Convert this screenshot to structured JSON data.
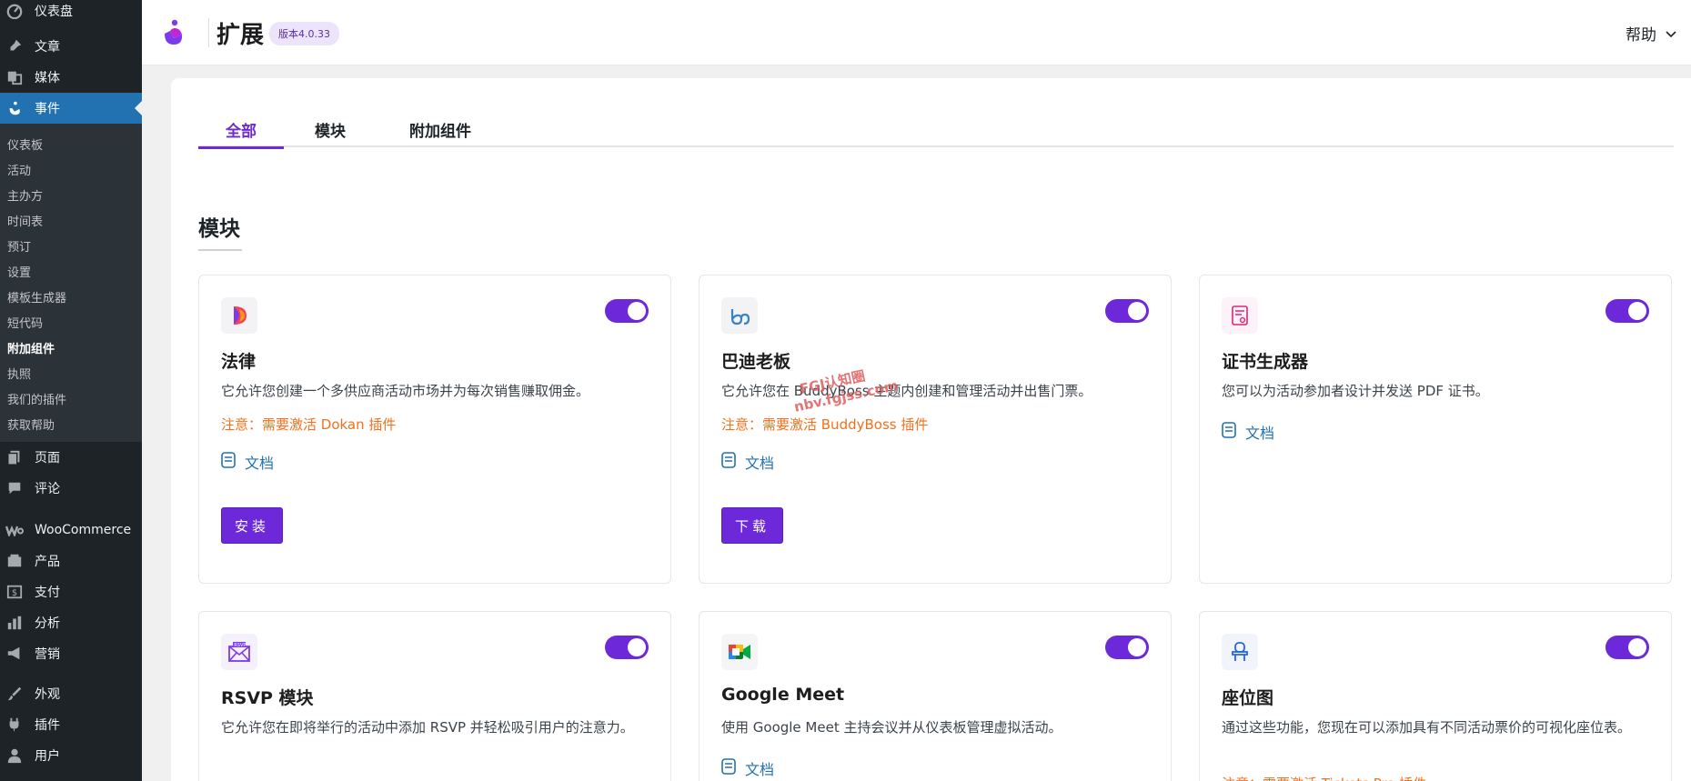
{
  "sidebar": {
    "top_items": [
      {
        "label": "仪表盘",
        "icon": "dashboard-icon"
      },
      {
        "label": "文章",
        "icon": "pin-icon"
      },
      {
        "label": "媒体",
        "icon": "media-icon"
      },
      {
        "label": "事件",
        "icon": "events-icon"
      }
    ],
    "submenu": [
      "仪表板",
      "活动",
      "主办方",
      "时间表",
      "预订",
      "设置",
      "模板生成器",
      "短代码",
      "附加组件",
      "执照",
      "我们的插件",
      "获取帮助"
    ],
    "bottom_items": [
      {
        "label": "页面",
        "icon": "pages-icon"
      },
      {
        "label": "评论",
        "icon": "comments-icon"
      },
      {
        "label": "WooCommerce",
        "icon": "woocommerce-icon"
      },
      {
        "label": "产品",
        "icon": "products-icon"
      },
      {
        "label": "支付",
        "icon": "payments-icon"
      },
      {
        "label": "分析",
        "icon": "analytics-icon"
      },
      {
        "label": "营销",
        "icon": "marketing-icon"
      },
      {
        "label": "外观",
        "icon": "appearance-icon"
      },
      {
        "label": "插件",
        "icon": "plugins-icon"
      },
      {
        "label": "用户",
        "icon": "users-icon"
      }
    ]
  },
  "header": {
    "title": "扩展",
    "version": "版本4.0.33",
    "help": "帮助"
  },
  "tabs": [
    "全部",
    "模块",
    "附加组件"
  ],
  "section_title": "模块",
  "doc_label": "文档",
  "cards": [
    {
      "title": "法律",
      "desc": "它允许您创建一个多供应商活动市场并为每次销售赚取佣金。",
      "note": "注意：需要激活 Dokan 插件",
      "button": "安装",
      "icon": "dokan-icon",
      "toggle_on": true
    },
    {
      "title": "巴迪老板",
      "desc": "它允许您在 BuddyBoss 主题内创建和管理活动并出售门票。",
      "note": "注意：需要激活 BuddyBoss 插件",
      "button": "下载",
      "icon": "buddyboss-icon",
      "toggle_on": true
    },
    {
      "title": "证书生成器",
      "desc": "您可以为活动参加者设计并发送 PDF 证书。",
      "icon": "certificate-icon",
      "toggle_on": true
    },
    {
      "title": "RSVP 模块",
      "desc": "它允许您在即将举行的活动中添加 RSVP 并轻松吸引用户的注意力。",
      "icon": "rsvp-icon",
      "toggle_on": true
    },
    {
      "title": "Google Meet",
      "desc": "使用 Google Meet 主持会议并从仪表板管理虚拟活动。",
      "icon": "google-meet-icon",
      "toggle_on": true
    },
    {
      "title": "座位图",
      "desc": "通过这些功能，您现在可以添加具有不同活动票价的可视化座位表。",
      "note": "注意：需要激活 Tickets Pro 插件",
      "icon": "seat-map-icon",
      "toggle_on": true
    }
  ],
  "watermark": {
    "line1": "FGJ认知圈",
    "line2": "nbv.fgjss.com"
  },
  "colors": {
    "accent": "#6d28d9",
    "sidebar_bg": "#1d2327",
    "active_menu": "#2271b1",
    "note": "#f2711c",
    "link": "#2271b1"
  }
}
